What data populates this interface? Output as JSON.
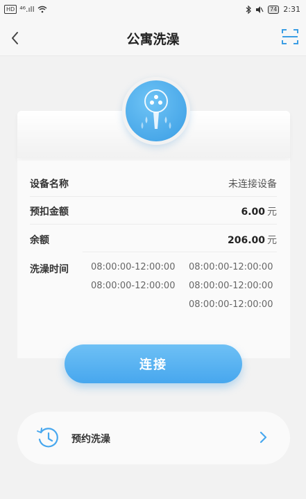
{
  "statusbar": {
    "left_badge": "HD",
    "signal": "⁴⁶.ıll",
    "battery": "74",
    "time": "2:31"
  },
  "header": {
    "title": "公寓洗澡"
  },
  "device": {
    "name_label": "设备名称",
    "name_value": "未连接设备",
    "deposit_label": "预扣金额",
    "deposit_value": "6.00",
    "balance_label": "余额",
    "balance_value": "206.00",
    "currency_unit": "元",
    "time_label": "洗澡时间",
    "time_slots": [
      "08:00:00-12:00:00",
      "08:00:00-12:00:00",
      "08:00:00-12:00:00",
      "08:00:00-12:00:00",
      "08:00:00-12:00:00"
    ]
  },
  "connect_label": "连接",
  "reserve": {
    "label": "预约洗澡"
  },
  "colors": {
    "accent": "#47a7ee",
    "background": "#f2f2f2"
  }
}
